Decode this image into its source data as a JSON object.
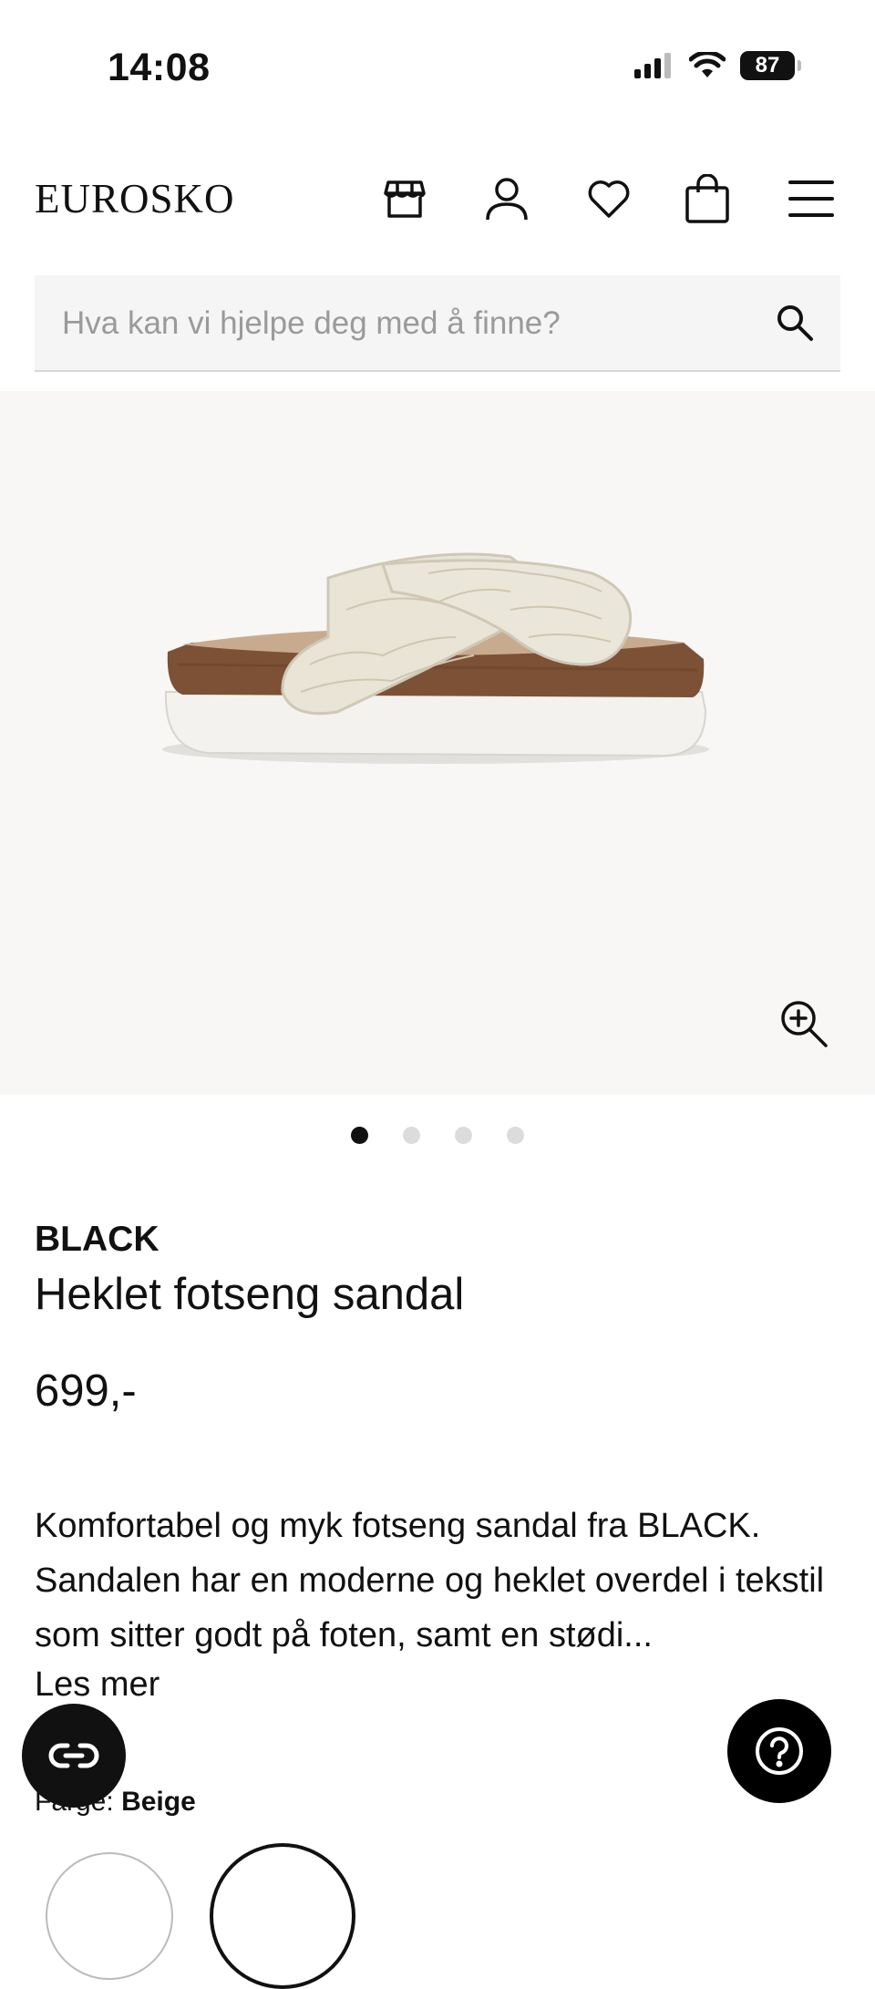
{
  "status_bar": {
    "time": "14:08",
    "battery": "87"
  },
  "header": {
    "logo": "EUROSKO",
    "icons": [
      "store-icon",
      "account-icon",
      "heart-icon",
      "bag-icon",
      "menu-icon"
    ]
  },
  "search": {
    "placeholder": "Hva kan vi hjelpe deg med å finne?"
  },
  "gallery": {
    "image_count": 4,
    "active_index": 0
  },
  "product": {
    "brand": "BLACK",
    "name": "Heklet fotseng sandal",
    "price": "699,-",
    "description": "Komfortabel og myk fotseng sandal fra BLACK. Sandalen har en moderne og heklet overdel i tekstil som sitter godt på foten, samt en stødi...",
    "read_more": "Les mer",
    "color_label": "Farge:",
    "color_value": "Beige"
  },
  "colors": {
    "accent": "#111111",
    "gallery_bg": "#f8f7f5",
    "search_bg": "#f5f5f5"
  }
}
